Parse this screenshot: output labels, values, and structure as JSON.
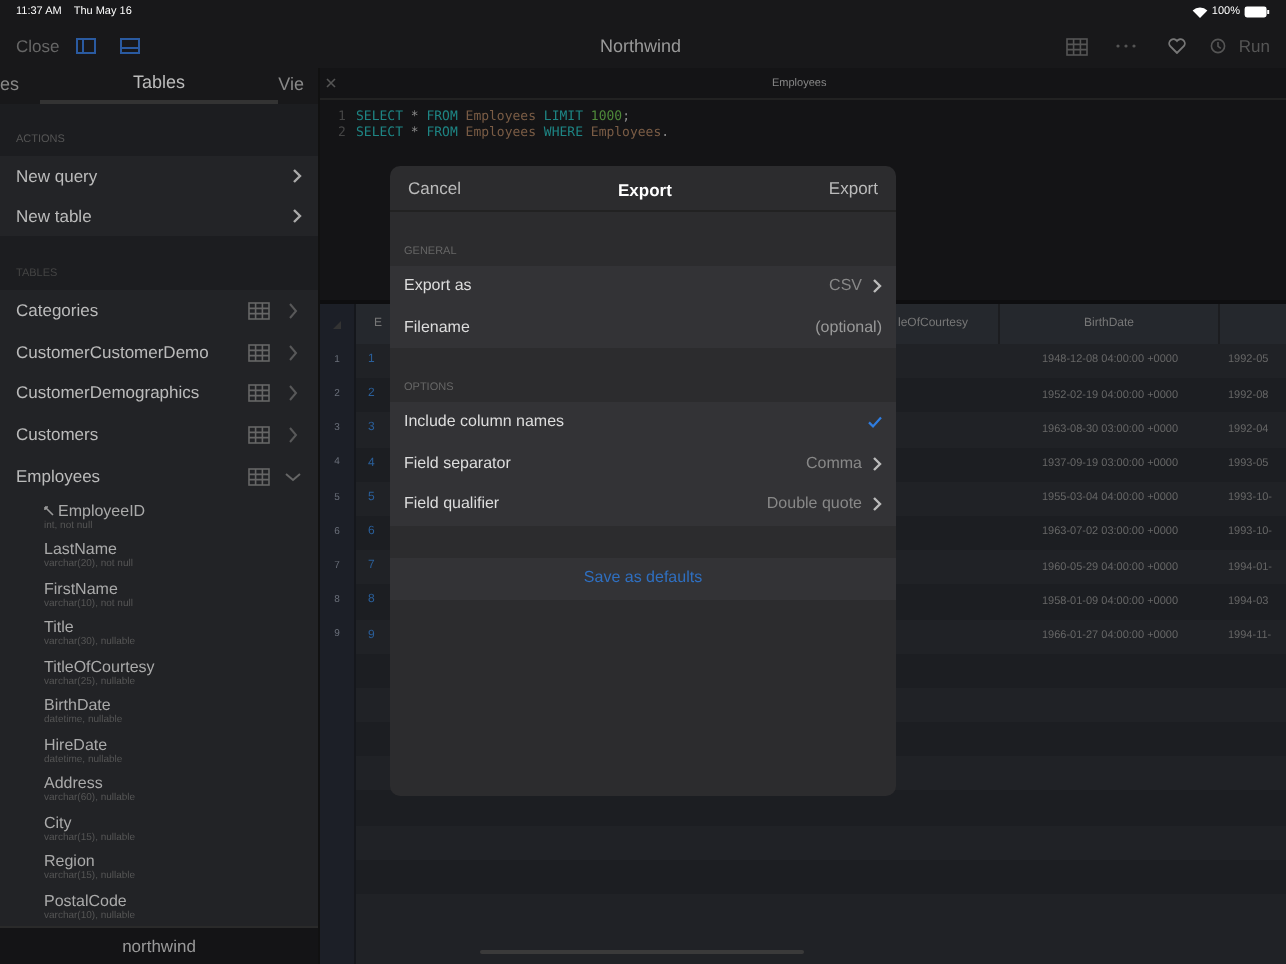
{
  "status_bar": {
    "time": "11:37 AM",
    "date": "Thu May 16",
    "battery": "100%"
  },
  "toolbar": {
    "close": "Close",
    "title": "Northwind",
    "run": "Run"
  },
  "sidebar": {
    "tabs": [
      {
        "label": "es",
        "selected": false
      },
      {
        "label": "Tables",
        "selected": true
      },
      {
        "label": "Vie",
        "selected": false
      }
    ],
    "actions_header": "ACTIONS",
    "actions": [
      "New query",
      "New table"
    ],
    "tables_header": "TABLES",
    "tables": [
      {
        "name": "Categories",
        "expanded": false
      },
      {
        "name": "CustomerCustomerDemo",
        "expanded": false
      },
      {
        "name": "CustomerDemographics",
        "expanded": false
      },
      {
        "name": "Customers",
        "expanded": false
      },
      {
        "name": "Employees",
        "expanded": true,
        "children": [
          {
            "name": "EmployeeID",
            "type": "int, not null",
            "key": true
          },
          {
            "name": "LastName",
            "type": "varchar(20), not null",
            "key": false
          },
          {
            "name": "FirstName",
            "type": "varchar(10), not null",
            "key": false
          },
          {
            "name": "Title",
            "type": "varchar(30), nullable",
            "key": false
          },
          {
            "name": "TitleOfCourtesy",
            "type": "varchar(25), nullable",
            "key": false
          },
          {
            "name": "BirthDate",
            "type": "datetime, nullable",
            "key": false
          },
          {
            "name": "HireDate",
            "type": "datetime, nullable",
            "key": false
          },
          {
            "name": "Address",
            "type": "varchar(60), nullable",
            "key": false
          },
          {
            "name": "City",
            "type": "varchar(15), nullable",
            "key": false
          },
          {
            "name": "Region",
            "type": "varchar(15), nullable",
            "key": false
          },
          {
            "name": "PostalCode",
            "type": "varchar(10), nullable",
            "key": false
          }
        ]
      }
    ],
    "footer": "northwind"
  },
  "editor": {
    "tab_title": "Employees",
    "lines": [
      {
        "number": "1",
        "tokens": [
          {
            "kind": "keyword",
            "text": "SELECT"
          },
          {
            "kind": "operator",
            "text": "*"
          },
          {
            "kind": "keyword",
            "text": "FROM"
          },
          {
            "kind": "identifier",
            "text": "Employees"
          },
          {
            "kind": "keyword",
            "text": "LIMIT"
          },
          {
            "kind": "number",
            "text": "1000"
          },
          {
            "kind": "punctuation",
            "text": ";"
          }
        ]
      },
      {
        "number": "2",
        "tokens": [
          {
            "kind": "keyword",
            "text": "SELECT"
          },
          {
            "kind": "operator",
            "text": "*"
          },
          {
            "kind": "keyword",
            "text": "FROM"
          },
          {
            "kind": "identifier",
            "text": "Employees"
          },
          {
            "kind": "keyword",
            "text": "WHERE"
          },
          {
            "kind": "identifier",
            "text": "Employees"
          },
          {
            "kind": "punctuation",
            "text": "."
          }
        ]
      }
    ]
  },
  "grid": {
    "columns": [
      "E",
      "leOfCourtesy",
      "BirthDate"
    ],
    "rows": [
      {
        "number": "1",
        "id": "1",
        "birth_date": "1948-12-08 04:00:00 +0000",
        "column_4": "1992-05"
      },
      {
        "number": "2",
        "id": "2",
        "birth_date": "1952-02-19 04:00:00 +0000",
        "column_4": "1992-08"
      },
      {
        "number": "3",
        "id": "3",
        "birth_date": "1963-08-30 03:00:00 +0000",
        "column_4": "1992-04"
      },
      {
        "number": "4",
        "id": "4",
        "birth_date": "1937-09-19 03:00:00 +0000",
        "column_4": "1993-05"
      },
      {
        "number": "5",
        "id": "5",
        "birth_date": "1955-03-04 04:00:00 +0000",
        "column_4": "1993-10-"
      },
      {
        "number": "6",
        "id": "6",
        "birth_date": "1963-07-02 03:00:00 +0000",
        "column_4": "1993-10-"
      },
      {
        "number": "7",
        "id": "7",
        "birth_date": "1960-05-29 04:00:00 +0000",
        "column_4": "1994-01-"
      },
      {
        "number": "8",
        "id": "8",
        "birth_date": "1958-01-09 04:00:00 +0000",
        "column_4": "1994-03"
      },
      {
        "number": "9",
        "id": "9",
        "birth_date": "1966-01-27 04:00:00 +0000",
        "column_4": "1994-11-"
      }
    ]
  },
  "dialog": {
    "cancel": "Cancel",
    "title": "Export",
    "confirm": "Export",
    "sections": [
      {
        "header": "GENERAL",
        "rows": [
          {
            "kind": "value",
            "label": "Export as",
            "value": "CSV"
          },
          {
            "kind": "field",
            "label": "Filename",
            "placeholder": "(optional)"
          }
        ]
      },
      {
        "header": "OPTIONS",
        "rows": [
          {
            "kind": "check",
            "label": "Include column names",
            "checked": true
          },
          {
            "kind": "value",
            "label": "Field separator",
            "value": "Comma"
          },
          {
            "kind": "value",
            "label": "Field qualifier",
            "value": "Double quote"
          }
        ]
      }
    ],
    "save_button": "Save as defaults"
  }
}
